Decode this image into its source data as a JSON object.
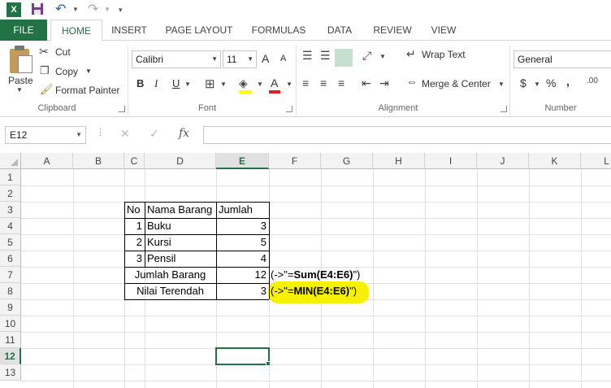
{
  "colors": {
    "accent": "#217346",
    "highlight": "#f7f000"
  },
  "qat": {
    "logo_text": "X",
    "icons": [
      "excel-logo",
      "save-icon",
      "undo-icon",
      "redo-icon",
      "customize-icon"
    ]
  },
  "tabs": [
    "FILE",
    "HOME",
    "INSERT",
    "PAGE LAYOUT",
    "FORMULAS",
    "DATA",
    "REVIEW",
    "VIEW"
  ],
  "active_tab": "HOME",
  "ribbon": {
    "clipboard": {
      "label": "Clipboard",
      "paste": "Paste",
      "cut": "Cut",
      "copy": "Copy",
      "format_painter": "Format Painter"
    },
    "font": {
      "label": "Font",
      "font_name": "Calibri",
      "font_size": "11",
      "grow": "A",
      "shrink": "A",
      "bold": "B",
      "italic": "I",
      "underline": "U",
      "font_color": "A"
    },
    "alignment": {
      "label": "Alignment",
      "wrap_text": "Wrap Text",
      "merge_center": "Merge & Center"
    },
    "number": {
      "label": "Number",
      "format": "General",
      "currency": "$",
      "percent": "%",
      "comma": ","
    }
  },
  "formula_bar": {
    "name_box": "E12",
    "fx": "fx",
    "formula": ""
  },
  "grid": {
    "columns": [
      "A",
      "B",
      "C",
      "D",
      "E",
      "F",
      "G",
      "H",
      "I",
      "J",
      "K",
      "L"
    ],
    "rows": [
      "1",
      "2",
      "3",
      "4",
      "5",
      "6",
      "7",
      "8",
      "9",
      "10",
      "11",
      "12",
      "13"
    ],
    "selected_column": "E",
    "selected_row": "12",
    "table": {
      "header": {
        "no": "No",
        "nama": "Nama Barang",
        "jumlah": "Jumlah"
      },
      "items": [
        {
          "no": "1",
          "nama": "Buku",
          "jumlah": "3"
        },
        {
          "no": "2",
          "nama": "Kursi",
          "jumlah": "5"
        },
        {
          "no": "3",
          "nama": "Pensil",
          "jumlah": "4"
        }
      ],
      "total_label": "Jumlah Barang",
      "total_value": "12",
      "min_label": "Nilai Terendah",
      "min_value": "3"
    },
    "notes": {
      "sum_prefix": "(->\"=",
      "sum_formula": "Sum(E4:E6)",
      "sum_suffix": "\")",
      "min_prefix": "(->\"=",
      "min_formula": "MIN(E4:E6)",
      "min_suffix": "\")"
    }
  }
}
